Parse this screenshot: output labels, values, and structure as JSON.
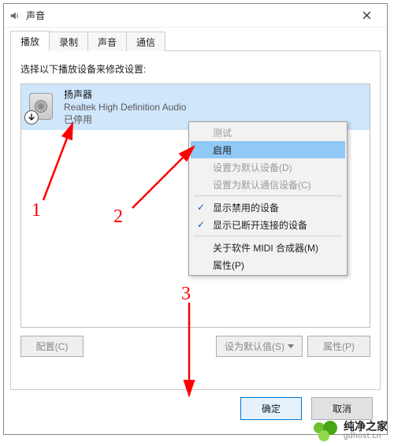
{
  "window": {
    "title": "声音",
    "close_icon": "close"
  },
  "tabs": [
    {
      "label": "播放"
    },
    {
      "label": "录制"
    },
    {
      "label": "声音"
    },
    {
      "label": "通信"
    }
  ],
  "instruction": "选择以下播放设备来修改设置:",
  "device": {
    "title": "扬声器",
    "subtitle": "Realtek High Definition Audio",
    "status": "已停用"
  },
  "context_menu": {
    "items": [
      {
        "label": "测试",
        "disabled": true
      },
      {
        "label": "启用",
        "highlight": true
      },
      {
        "label": "设置为默认设备(D)",
        "disabled": true
      },
      {
        "label": "设置为默认通信设备(C)",
        "disabled": true
      }
    ],
    "group2": [
      {
        "label": "显示禁用的设备",
        "checked": true
      },
      {
        "label": "显示已断开连接的设备",
        "checked": true
      }
    ],
    "group3": [
      {
        "label": "关于软件 MIDI 合成器(M)"
      },
      {
        "label": "属性(P)"
      }
    ]
  },
  "panel_buttons": {
    "configure": "配置(C)",
    "set_default": "设为默认值(S)",
    "properties": "属性(P)"
  },
  "bottom_buttons": {
    "ok": "确定",
    "cancel": "取消"
  },
  "annotations": {
    "n1": "1",
    "n2": "2",
    "n3": "3"
  },
  "watermark": {
    "name": "纯净之家",
    "url": "gdhost.cn"
  }
}
